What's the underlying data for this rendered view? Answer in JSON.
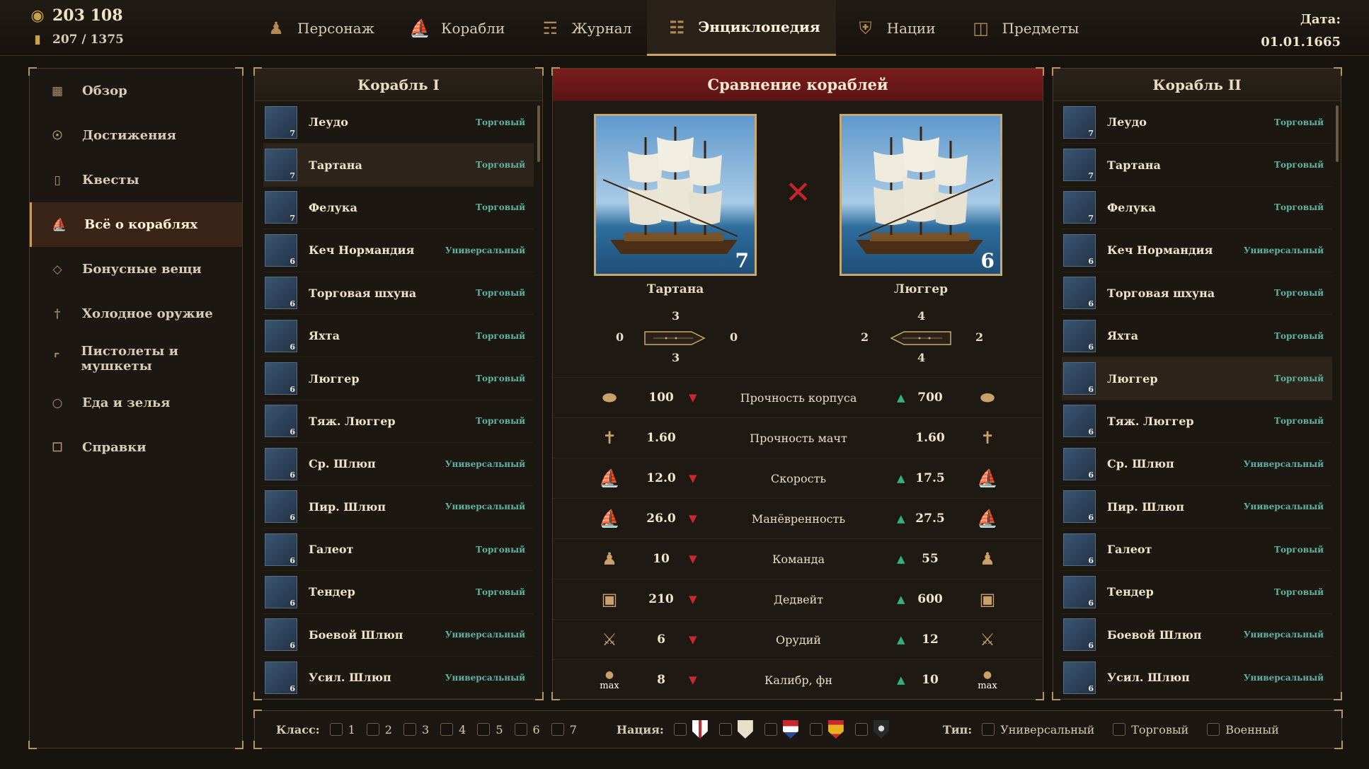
{
  "resources": {
    "gold": "203 108",
    "crew": "207 / 1375"
  },
  "tabs": [
    {
      "label": "Персонаж",
      "icon": "character-icon"
    },
    {
      "label": "Корабли",
      "icon": "ship-icon"
    },
    {
      "label": "Журнал",
      "icon": "journal-icon"
    },
    {
      "label": "Энциклопедия",
      "icon": "book-icon",
      "active": true
    },
    {
      "label": "Нации",
      "icon": "shield-icon"
    },
    {
      "label": "Предметы",
      "icon": "chest-icon"
    }
  ],
  "date": {
    "label": "Дата:",
    "value": "01.01.1665"
  },
  "sidebar": {
    "items": [
      {
        "label": "Обзор"
      },
      {
        "label": "Достижения"
      },
      {
        "label": "Квесты"
      },
      {
        "label": "Всё о кораблях",
        "active": true
      },
      {
        "label": "Бонусные вещи"
      },
      {
        "label": "Холодное оружие"
      },
      {
        "label": "Пистолеты и мушкеты"
      },
      {
        "label": "Еда и зелья"
      },
      {
        "label": "Справки"
      }
    ]
  },
  "ships": [
    {
      "name": "Леудо",
      "type": "Торговый",
      "class": "7"
    },
    {
      "name": "Тартана",
      "type": "Торговый",
      "class": "7"
    },
    {
      "name": "Фелука",
      "type": "Торговый",
      "class": "7"
    },
    {
      "name": "Кеч Нормандия",
      "type": "Универсальный",
      "class": "6"
    },
    {
      "name": "Торговая шхуна",
      "type": "Торговый",
      "class": "6"
    },
    {
      "name": "Яхта",
      "type": "Торговый",
      "class": "6"
    },
    {
      "name": "Люггер",
      "type": "Торговый",
      "class": "6"
    },
    {
      "name": "Тяж. Люггер",
      "type": "Торговый",
      "class": "6"
    },
    {
      "name": "Ср. Шлюп",
      "type": "Универсальный",
      "class": "6"
    },
    {
      "name": "Пир. Шлюп",
      "type": "Универсальный",
      "class": "6"
    },
    {
      "name": "Галеот",
      "type": "Торговый",
      "class": "6"
    },
    {
      "name": "Тендер",
      "type": "Торговый",
      "class": "6"
    },
    {
      "name": "Боевой Шлюп",
      "type": "Универсальный",
      "class": "6"
    },
    {
      "name": "Усил. Шлюп",
      "type": "Универсальный",
      "class": "6"
    }
  ],
  "left_panel": {
    "title": "Корабль I",
    "selected": "Тартана"
  },
  "right_panel": {
    "title": "Корабль II",
    "selected": "Люггер"
  },
  "comparison": {
    "title": "Сравнение кораблей",
    "left_ship": {
      "name": "Тартана",
      "class": "7",
      "guns": {
        "front": "3",
        "back": "3",
        "left": "0",
        "right": "0"
      }
    },
    "right_ship": {
      "name": "Люггер",
      "class": "6",
      "guns": {
        "front": "4",
        "back": "4",
        "left": "2",
        "right": "2"
      }
    },
    "stats": [
      {
        "name": "Прочность корпуса",
        "left": "100",
        "right": "700",
        "diff": true,
        "icon": "hull-icon"
      },
      {
        "name": "Прочность мачт",
        "left": "1.60",
        "right": "1.60",
        "diff": false,
        "icon": "mast-icon"
      },
      {
        "name": "Скорость",
        "left": "12.0",
        "right": "17.5",
        "diff": true,
        "icon": "speed-icon"
      },
      {
        "name": "Манёвренность",
        "left": "26.0",
        "right": "27.5",
        "diff": true,
        "icon": "maneuver-icon"
      },
      {
        "name": "Команда",
        "left": "10",
        "right": "55",
        "diff": true,
        "icon": "crew-icon"
      },
      {
        "name": "Дедвейт",
        "left": "210",
        "right": "600",
        "diff": true,
        "icon": "cargo-icon"
      },
      {
        "name": "Орудий",
        "left": "6",
        "right": "12",
        "diff": true,
        "icon": "cannon-icon"
      },
      {
        "name": "Калибр, фн",
        "left": "8",
        "right": "10",
        "diff": true,
        "icon": "cannonball-icon",
        "icon_text": "max"
      }
    ]
  },
  "filters": {
    "class_label": "Класс:",
    "classes": [
      "1",
      "2",
      "3",
      "4",
      "5",
      "6",
      "7"
    ],
    "nation_label": "Нация:",
    "nations": [
      {
        "name": "england-flag",
        "color": "#ffffff"
      },
      {
        "name": "france-flag",
        "color": "#e8e0c8"
      },
      {
        "name": "holland-flag",
        "color": "#c8282e"
      },
      {
        "name": "spain-flag",
        "color": "#e0a020"
      },
      {
        "name": "pirate-flag",
        "color": "#2a2a2a"
      }
    ],
    "type_label": "Тип:",
    "types": [
      "Универсальный",
      "Торговый",
      "Военный"
    ]
  }
}
